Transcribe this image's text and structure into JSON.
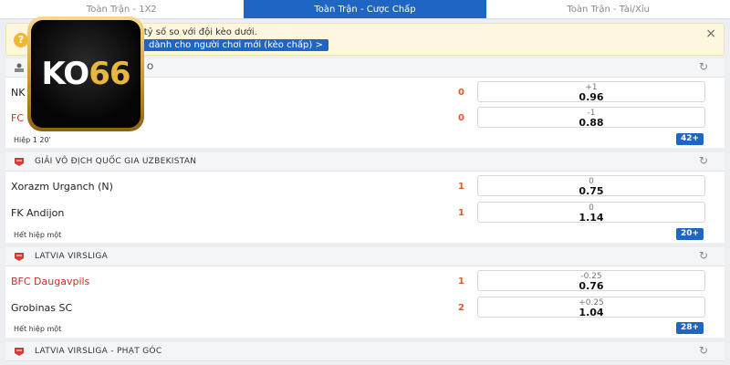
{
  "tabs": [
    {
      "label": "Toàn Trận - 1X2"
    },
    {
      "label": "Toàn Trận - Cược Chấp"
    },
    {
      "label": "Toàn Trận - Tài/Xỉu"
    }
  ],
  "banner": {
    "line1": "ừa đội kèo trên có chấp tỷ số so với đội kèo dưới.",
    "line2": "dành cho người chơi mới (kèo chấp) >",
    "close": "×"
  },
  "logo": {
    "text_a": "KO",
    "text_b": "66"
  },
  "leagues": [
    {
      "name": "O",
      "matches_status": "Hiệp 1 20'",
      "more": "42+",
      "home": {
        "name": "NK",
        "score": "0",
        "line": "+1",
        "price": "0.96"
      },
      "away": {
        "name": "FC",
        "score": "0",
        "line": "-1",
        "price": "0.88"
      }
    },
    {
      "name": "GIẢI VÔ ĐỊCH QUỐC GIA UZBEKISTAN",
      "matches_status": "Hết hiệp một",
      "more": "20+",
      "home": {
        "name": "Xorazm Urganch (N)",
        "score": "1",
        "line": "0",
        "price": "0.75"
      },
      "away": {
        "name": "FK Andijon",
        "score": "1",
        "line": "0",
        "price": "1.14"
      }
    },
    {
      "name": "LATVIA VIRSLIGA",
      "matches_status": "Hết hiệp một",
      "more": "28+",
      "home": {
        "name": "BFC Daugavpils",
        "score": "1",
        "line": "-0.25",
        "price": "0.76"
      },
      "away": {
        "name": "Grobinas SC",
        "score": "2",
        "line": "+0.25",
        "price": "1.04"
      }
    },
    {
      "name": "LATVIA VIRSLIGA - PHẠT GÓC"
    }
  ]
}
